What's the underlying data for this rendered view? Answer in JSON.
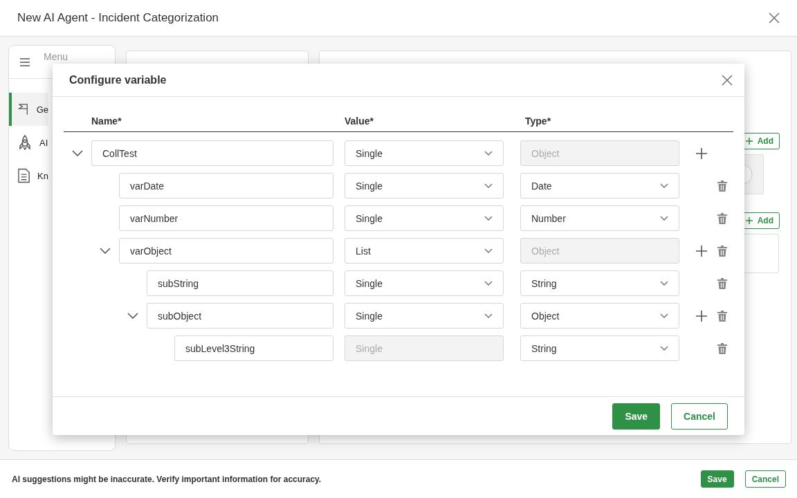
{
  "window": {
    "title": "New AI Agent - Incident Categorization"
  },
  "sidebar": {
    "menu_label": "Menu",
    "items": [
      {
        "label": "Ge",
        "selected": true
      },
      {
        "label": "AI",
        "selected": false
      },
      {
        "label": "Kn",
        "selected": false
      }
    ]
  },
  "right_panel": {
    "add_buttons": [
      "Add",
      "Add"
    ]
  },
  "dialog": {
    "title": "Configure variable",
    "columns": [
      "Name*",
      "Value*",
      "Type*"
    ],
    "variables": [
      {
        "name": "CollTest",
        "value": "Single",
        "value_disabled": false,
        "type": "Object",
        "type_disabled": true,
        "expanded": true,
        "can_add": true,
        "can_delete": false,
        "children": [
          {
            "name": "varDate",
            "value": "Single",
            "value_disabled": false,
            "type": "Date",
            "type_disabled": false,
            "can_add": false,
            "can_delete": true
          },
          {
            "name": "varNumber",
            "value": "Single",
            "value_disabled": false,
            "type": "Number",
            "type_disabled": false,
            "can_add": false,
            "can_delete": true
          },
          {
            "name": "varObject",
            "value": "List",
            "value_disabled": false,
            "type": "Object",
            "type_disabled": true,
            "expanded": true,
            "can_add": true,
            "can_delete": true,
            "children": [
              {
                "name": "subString",
                "value": "Single",
                "value_disabled": false,
                "type": "String",
                "type_disabled": false,
                "can_add": false,
                "can_delete": true
              },
              {
                "name": "subObject",
                "value": "Single",
                "value_disabled": false,
                "type": "Object",
                "type_disabled": false,
                "expanded": true,
                "can_add": true,
                "can_delete": true,
                "children": [
                  {
                    "name": "subLevel3String",
                    "value": "Single",
                    "value_disabled": true,
                    "type": "String",
                    "type_disabled": false,
                    "can_add": false,
                    "can_delete": true
                  }
                ]
              }
            ]
          }
        ]
      }
    ],
    "buttons": [
      {
        "label": "Save",
        "kind": "primary"
      },
      {
        "label": "Cancel",
        "kind": "secondary"
      }
    ]
  },
  "footer": {
    "notice": "AI suggestions might be inaccurate. Verify important information for accuracy.",
    "buttons": [
      {
        "label": "Save",
        "kind": "primary"
      },
      {
        "label": "Cancel",
        "kind": "secondary"
      }
    ]
  }
}
